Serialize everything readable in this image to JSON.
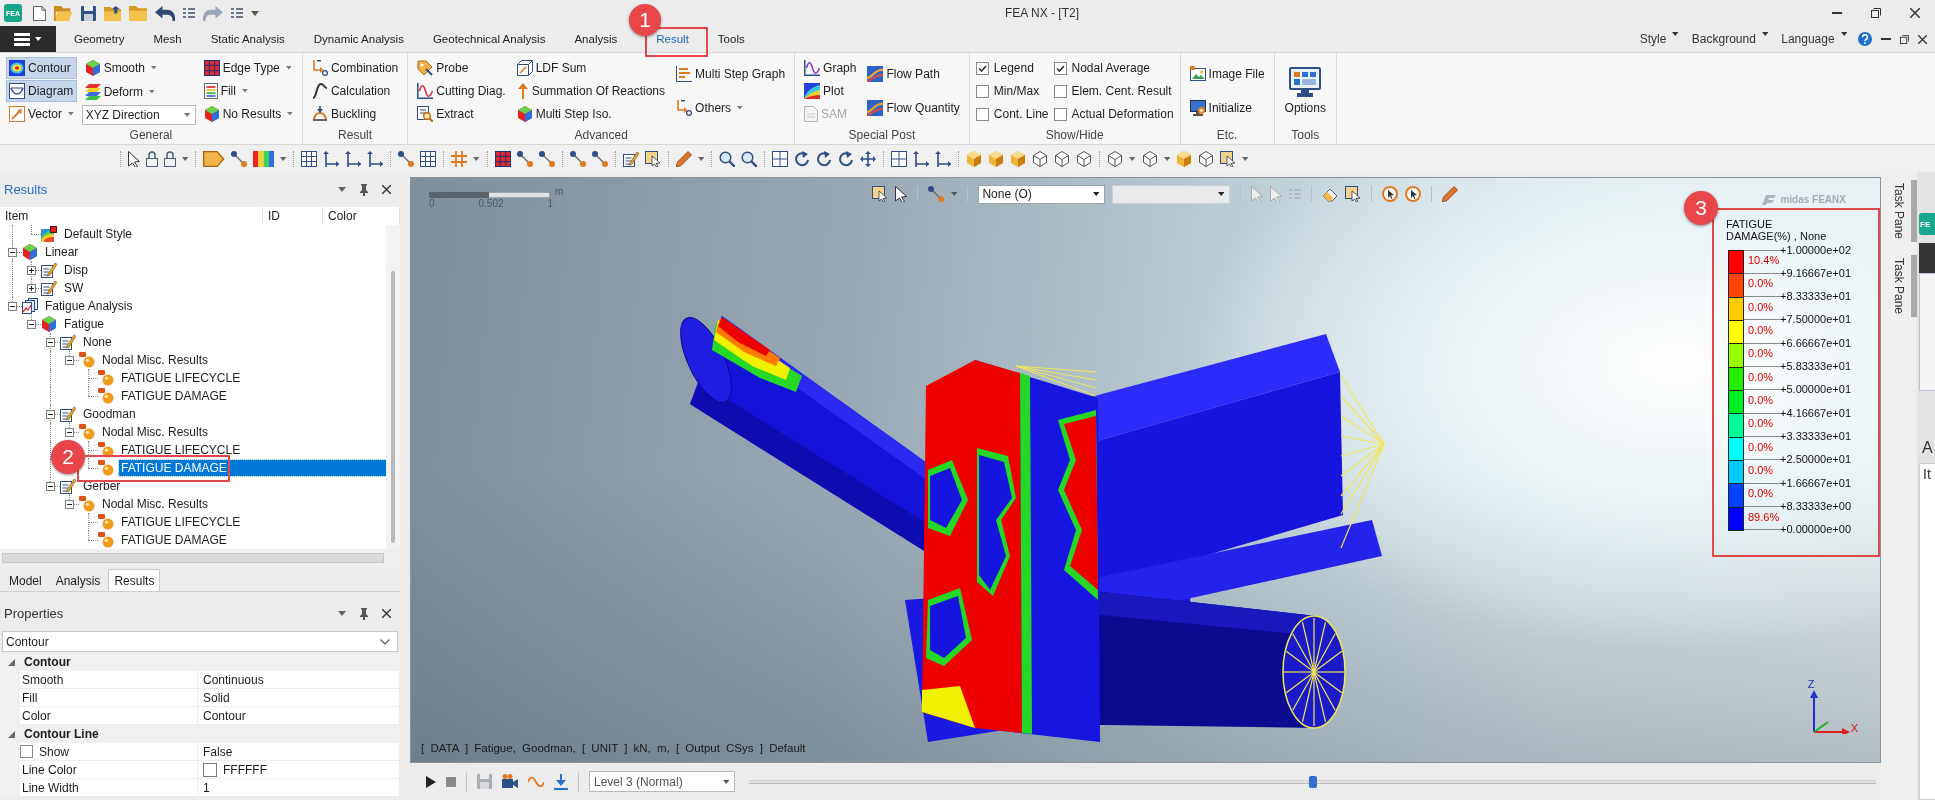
{
  "window": {
    "logo": "FEA",
    "title": "FEA NX - [T2]"
  },
  "menu_tabs": [
    {
      "label": "Geometry",
      "selected": false
    },
    {
      "label": "Mesh",
      "selected": false
    },
    {
      "label": "Static Analysis",
      "selected": false
    },
    {
      "label": "Dynamic Analysis",
      "selected": false
    },
    {
      "label": "Geotechnical Analysis",
      "selected": false
    },
    {
      "label": "Analysis",
      "selected": false
    },
    {
      "label": "Result",
      "selected": true
    },
    {
      "label": "Tools",
      "selected": false
    }
  ],
  "header_menus": [
    "Style",
    "Background",
    "Language"
  ],
  "ribbon": [
    {
      "title": "General",
      "columns": [
        [
          {
            "kind": "toggle",
            "label": "Contour",
            "selected": true
          },
          {
            "kind": "toggle",
            "label": "Diagram",
            "selected": true
          },
          {
            "kind": "dropdown",
            "label": "Vector"
          }
        ],
        [
          {
            "kind": "dropdown",
            "label": "Smooth"
          },
          {
            "kind": "dropdown",
            "label": "Deform"
          },
          {
            "kind": "combo",
            "value": "XYZ Direction"
          }
        ],
        [
          {
            "kind": "dropdown",
            "label": "Edge Type"
          },
          {
            "kind": "dropdown",
            "label": "Fill"
          },
          {
            "kind": "dropdown",
            "label": "No Results"
          }
        ]
      ]
    },
    {
      "title": "Result",
      "columns": [
        [
          {
            "kind": "button",
            "label": "Combination"
          },
          {
            "kind": "button",
            "label": "Calculation"
          },
          {
            "kind": "button",
            "label": "Buckling"
          }
        ]
      ]
    },
    {
      "title": "Advanced",
      "columns": [
        [
          {
            "kind": "button",
            "label": "Probe"
          },
          {
            "kind": "button",
            "label": "Cutting Diag."
          },
          {
            "kind": "button",
            "label": "Extract"
          }
        ],
        [
          {
            "kind": "button",
            "label": "LDF Sum"
          },
          {
            "kind": "button",
            "label": "Summation Of Reactions"
          },
          {
            "kind": "button",
            "label": "Multi Step Iso."
          }
        ],
        [
          {
            "kind": "button",
            "label": "Multi Step Graph"
          },
          {
            "kind": "dropdown",
            "label": "Others"
          }
        ]
      ]
    },
    {
      "title": "Special Post",
      "columns": [
        [
          {
            "kind": "button",
            "label": "Graph",
            "disabled": false
          },
          {
            "kind": "button",
            "label": "Plot",
            "disabled": false
          },
          {
            "kind": "button",
            "label": "SAM",
            "disabled": true
          }
        ],
        [
          {
            "kind": "button",
            "label": "Flow Path",
            "disabled": false
          },
          {
            "kind": "button",
            "label": "Flow Quantity",
            "disabled": false
          }
        ]
      ]
    },
    {
      "title": "Show/Hide",
      "columns": [
        [
          {
            "kind": "checkbox",
            "label": "Legend",
            "checked": true
          },
          {
            "kind": "checkbox",
            "label": "Min/Max",
            "checked": false
          },
          {
            "kind": "checkbox",
            "label": "Cont. Line",
            "checked": false
          }
        ],
        [
          {
            "kind": "checkbox",
            "label": "Nodal Average",
            "checked": true
          },
          {
            "kind": "checkbox",
            "label": "Elem. Cent. Result",
            "checked": false
          },
          {
            "kind": "checkbox",
            "label": "Actual Deformation",
            "checked": false
          }
        ]
      ]
    },
    {
      "title": "Etc.",
      "columns": [
        [
          {
            "kind": "button",
            "label": "Image File"
          },
          {
            "kind": "button",
            "label": "Initialize"
          }
        ]
      ]
    },
    {
      "title": "Tools",
      "columns": [
        [
          {
            "kind": "large",
            "label": "Options"
          }
        ]
      ]
    }
  ],
  "results_panel": {
    "title": "Results",
    "columns": [
      "Item",
      "ID",
      "Color"
    ],
    "tree": [
      {
        "children": [
          {
            "kind": "style",
            "label": "Default Style",
            "selected": false
          }
        ]
      },
      {
        "kind": "case",
        "label": "Linear",
        "expanded": true,
        "selected": false,
        "children": [
          {
            "kind": "function",
            "label": "Disp",
            "expanded": false,
            "selected": false
          },
          {
            "kind": "function",
            "label": "SW",
            "expanded": false,
            "selected": false
          }
        ]
      },
      {
        "kind": "analysis",
        "label": "Fatigue Analysis",
        "expanded": true,
        "selected": false,
        "children": [
          {
            "kind": "case",
            "label": "Fatigue",
            "expanded": true,
            "selected": false,
            "children": [
              {
                "kind": "function",
                "label": "None",
                "expanded": true,
                "selected": false,
                "children": [
                  {
                    "kind": "component",
                    "label": "Nodal Misc. Results",
                    "expanded": true,
                    "selected": false,
                    "children": [
                      {
                        "kind": "component",
                        "label": "FATIGUE LIFECYCLE",
                        "selected": false
                      },
                      {
                        "kind": "component",
                        "label": "FATIGUE DAMAGE",
                        "selected": false
                      }
                    ]
                  }
                ]
              },
              {
                "kind": "function",
                "label": "Goodman",
                "expanded": true,
                "selected": false,
                "children": [
                  {
                    "kind": "component",
                    "label": "Nodal Misc. Results",
                    "expanded": true,
                    "selected": false,
                    "children": [
                      {
                        "kind": "component",
                        "label": "FATIGUE LIFECYCLE",
                        "selected": false
                      },
                      {
                        "kind": "component",
                        "label": "FATIGUE DAMAGE",
                        "selected": true
                      }
                    ]
                  }
                ]
              },
              {
                "kind": "function",
                "label": "Gerber",
                "expanded": true,
                "selected": false,
                "children": [
                  {
                    "kind": "component",
                    "label": "Nodal Misc. Results",
                    "expanded": true,
                    "selected": false,
                    "children": [
                      {
                        "kind": "component",
                        "label": "FATIGUE LIFECYCLE",
                        "selected": false
                      },
                      {
                        "kind": "component",
                        "label": "FATIGUE DAMAGE",
                        "selected": false
                      }
                    ]
                  }
                ]
              }
            ]
          }
        ]
      }
    ],
    "tabs": [
      {
        "label": "Model",
        "selected": false
      },
      {
        "label": "Analysis",
        "selected": false
      },
      {
        "label": "Results",
        "selected": true
      }
    ]
  },
  "properties_panel": {
    "title": "Properties",
    "selector": "Contour",
    "groups": [
      {
        "title": "Contour",
        "expanded": true,
        "rows": [
          {
            "kind": "text",
            "name": "Smooth",
            "value": "Continuous"
          },
          {
            "kind": "text",
            "name": "Fill",
            "value": "Solid"
          },
          {
            "kind": "text",
            "name": "Color",
            "value": "Contour"
          }
        ]
      },
      {
        "title": "Contour Line",
        "expanded": true,
        "rows": [
          {
            "kind": "checkbox",
            "name": "Show",
            "checked": false,
            "value": "False"
          },
          {
            "kind": "color",
            "name": "Line Color",
            "color": "#ffffff",
            "value": "FFFFFF"
          },
          {
            "kind": "text",
            "name": "Line Width",
            "value": "1"
          }
        ]
      }
    ]
  },
  "viewport": {
    "logo": "midas **FEANX**",
    "scale_bar": {
      "unit": "m",
      "ticks": [
        "0",
        "0.502",
        "1"
      ]
    },
    "toolbar": {
      "display_select": "None (O)",
      "second_select": {
        "disabled": true
      }
    },
    "legend": {
      "title": "FATIGUE DAMAGE(%) , None",
      "bands": [
        {
          "color": "#ff0000",
          "share": "10.4%"
        },
        {
          "color": "#ff4400",
          "share": "0.0%"
        },
        {
          "color": "#ffcc00",
          "share": "0.0%"
        },
        {
          "color": "#ffff00",
          "share": "0.0%"
        },
        {
          "color": "#99ff00",
          "share": "0.0%"
        },
        {
          "color": "#22ee00",
          "share": "0.0%"
        },
        {
          "color": "#00ee22",
          "share": "0.0%"
        },
        {
          "color": "#00ff99",
          "share": "0.0%"
        },
        {
          "color": "#00ffff",
          "share": "0.0%"
        },
        {
          "color": "#00ccff",
          "share": "0.0%"
        },
        {
          "color": "#0044ff",
          "share": "0.0%"
        },
        {
          "color": "#0000ff",
          "share": "89.6%"
        }
      ],
      "ticks": [
        "+1.00000e+02",
        "+9.16667e+01",
        "+8.33333e+01",
        "+7.50000e+01",
        "+6.66667e+01",
        "+5.83333e+01",
        "+5.00000e+01",
        "+4.16667e+01",
        "+3.33333e+01",
        "+2.50000e+01",
        "+1.66667e+01",
        "+8.33333e+00",
        "+0.00000e+00"
      ]
    },
    "status": "[ DATA ] Fatigue, Goodman, [ UNIT ] kN, m, [ Output CSys ] Default",
    "axes": [
      "Z",
      "X"
    ]
  },
  "playback": {
    "level_select": "Level 3 (Normal)",
    "slider": {
      "level": 0.5
    }
  },
  "task_pane_tabs": [
    "Task Pane",
    "Task Pane"
  ],
  "side_panel": {
    "logo": "FE",
    "text_1": "A",
    "text_2": "It"
  },
  "callouts": [
    {
      "number": "1"
    },
    {
      "number": "2"
    },
    {
      "number": "3"
    }
  ]
}
